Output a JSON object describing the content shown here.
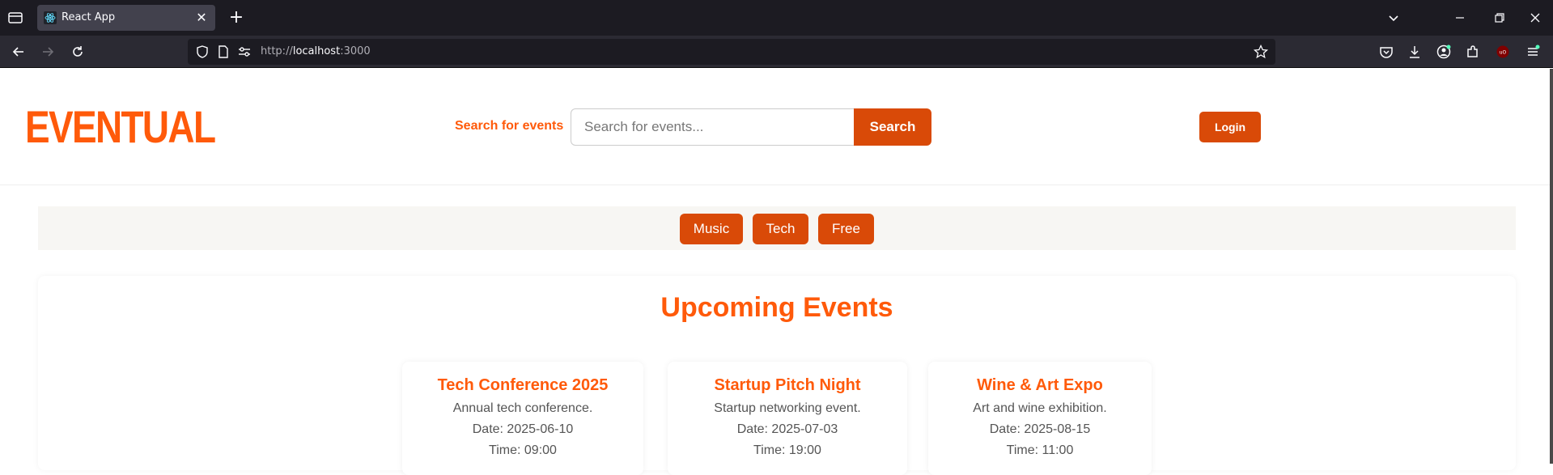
{
  "browser": {
    "tab_title": "React App",
    "url_prefix": "http://",
    "url_host": "localhost",
    "url_suffix": ":3000"
  },
  "header": {
    "logo": "EVENTUAL",
    "search_label": "Search for events",
    "search_placeholder": "Search for events...",
    "search_button": "Search",
    "login_button": "Login"
  },
  "filters": [
    "Music",
    "Tech",
    "Free"
  ],
  "events": {
    "title": "Upcoming Events",
    "cards": [
      {
        "title": "Tech Conference 2025",
        "description": "Annual tech conference.",
        "date": "Date: 2025-06-10",
        "time": "Time: 09:00"
      },
      {
        "title": "Startup Pitch Night",
        "description": "Startup networking event.",
        "date": "Date: 2025-07-03",
        "time": "Time: 19:00"
      },
      {
        "title": "Wine & Art Expo",
        "description": "Art and wine exhibition.",
        "date": "Date: 2025-08-15",
        "time": "Time: 11:00"
      }
    ]
  },
  "colors": {
    "brand": "#ff5a0a",
    "button": "#d94a08",
    "chrome_dark": "#1c1b22"
  }
}
